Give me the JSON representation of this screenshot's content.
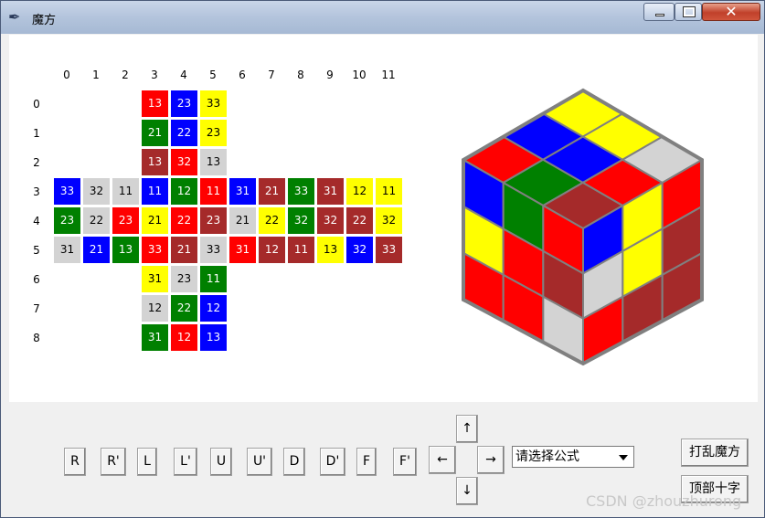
{
  "window": {
    "title": "魔方"
  },
  "colors": {
    "r": "#ff0000",
    "b": "#0000ff",
    "y": "#ffff00",
    "g": "#008000",
    "m": "#a52a2a",
    "w": "#d3d3d3"
  },
  "grid": {
    "col_labels": [
      "0",
      "1",
      "2",
      "3",
      "4",
      "5",
      "6",
      "7",
      "8",
      "9",
      "10",
      "11"
    ],
    "row_labels": [
      "0",
      "1",
      "2",
      "3",
      "4",
      "5",
      "6",
      "7",
      "8"
    ],
    "cells": [
      [
        "",
        "",
        "",
        {
          "t": "13",
          "c": "r"
        },
        {
          "t": "23",
          "c": "b"
        },
        {
          "t": "33",
          "c": "y"
        },
        "",
        "",
        "",
        "",
        "",
        ""
      ],
      [
        "",
        "",
        "",
        {
          "t": "21",
          "c": "g"
        },
        {
          "t": "22",
          "c": "b"
        },
        {
          "t": "23",
          "c": "y"
        },
        "",
        "",
        "",
        "",
        "",
        ""
      ],
      [
        "",
        "",
        "",
        {
          "t": "13",
          "c": "m"
        },
        {
          "t": "32",
          "c": "r"
        },
        {
          "t": "13",
          "c": "w"
        },
        "",
        "",
        "",
        "",
        "",
        ""
      ],
      [
        {
          "t": "33",
          "c": "b"
        },
        {
          "t": "32",
          "c": "w"
        },
        {
          "t": "11",
          "c": "w"
        },
        {
          "t": "11",
          "c": "b"
        },
        {
          "t": "12",
          "c": "g"
        },
        {
          "t": "11",
          "c": "r"
        },
        {
          "t": "31",
          "c": "b"
        },
        {
          "t": "21",
          "c": "m"
        },
        {
          "t": "33",
          "c": "g"
        },
        {
          "t": "31",
          "c": "m"
        },
        {
          "t": "12",
          "c": "y"
        },
        {
          "t": "11",
          "c": "y"
        }
      ],
      [
        {
          "t": "23",
          "c": "g"
        },
        {
          "t": "22",
          "c": "w"
        },
        {
          "t": "23",
          "c": "r"
        },
        {
          "t": "21",
          "c": "y"
        },
        {
          "t": "22",
          "c": "r"
        },
        {
          "t": "23",
          "c": "m"
        },
        {
          "t": "21",
          "c": "w"
        },
        {
          "t": "22",
          "c": "y"
        },
        {
          "t": "32",
          "c": "g"
        },
        {
          "t": "32",
          "c": "m"
        },
        {
          "t": "22",
          "c": "m"
        },
        {
          "t": "32",
          "c": "y"
        }
      ],
      [
        {
          "t": "31",
          "c": "w"
        },
        {
          "t": "21",
          "c": "b"
        },
        {
          "t": "13",
          "c": "g"
        },
        {
          "t": "33",
          "c": "r"
        },
        {
          "t": "21",
          "c": "m"
        },
        {
          "t": "33",
          "c": "w"
        },
        {
          "t": "31",
          "c": "r"
        },
        {
          "t": "12",
          "c": "m"
        },
        {
          "t": "11",
          "c": "m"
        },
        {
          "t": "13",
          "c": "y"
        },
        {
          "t": "32",
          "c": "b"
        },
        {
          "t": "33",
          "c": "m"
        }
      ],
      [
        "",
        "",
        "",
        {
          "t": "31",
          "c": "y"
        },
        {
          "t": "23",
          "c": "w"
        },
        {
          "t": "11",
          "c": "g"
        },
        "",
        "",
        "",
        "",
        "",
        ""
      ],
      [
        "",
        "",
        "",
        {
          "t": "12",
          "c": "w"
        },
        {
          "t": "22",
          "c": "g"
        },
        {
          "t": "12",
          "c": "b"
        },
        "",
        "",
        "",
        "",
        "",
        ""
      ],
      [
        "",
        "",
        "",
        {
          "t": "31",
          "c": "g"
        },
        {
          "t": "12",
          "c": "r"
        },
        {
          "t": "13",
          "c": "b"
        },
        "",
        "",
        "",
        "",
        "",
        ""
      ]
    ]
  },
  "cube": {
    "top": [
      [
        "r",
        "b",
        "y"
      ],
      [
        "g",
        "b",
        "y"
      ],
      [
        "m",
        "r",
        "w"
      ]
    ],
    "left": [
      [
        "b",
        "g",
        "r"
      ],
      [
        "y",
        "r",
        "m"
      ],
      [
        "r",
        "r",
        "w"
      ]
    ],
    "right": [
      [
        "b",
        "y",
        "r"
      ],
      [
        "w",
        "y",
        "m"
      ],
      [
        "r",
        "m",
        "m"
      ]
    ],
    "top_extra": [
      [
        "r"
      ],
      [
        "g",
        "b"
      ],
      [
        "m",
        "r"
      ]
    ]
  },
  "controls": {
    "moves": [
      "R",
      "R'",
      "L",
      "L'",
      "U",
      "U'",
      "D",
      "D'",
      "F",
      "F'"
    ],
    "arrow_up": "↑",
    "arrow_down": "↓",
    "arrow_left": "←",
    "arrow_right": "→",
    "formula_placeholder": "请选择公式",
    "scramble_label": "打乱魔方",
    "top_cross_label": "顶部十字"
  },
  "watermark": "CSDN @zhouzhurong"
}
